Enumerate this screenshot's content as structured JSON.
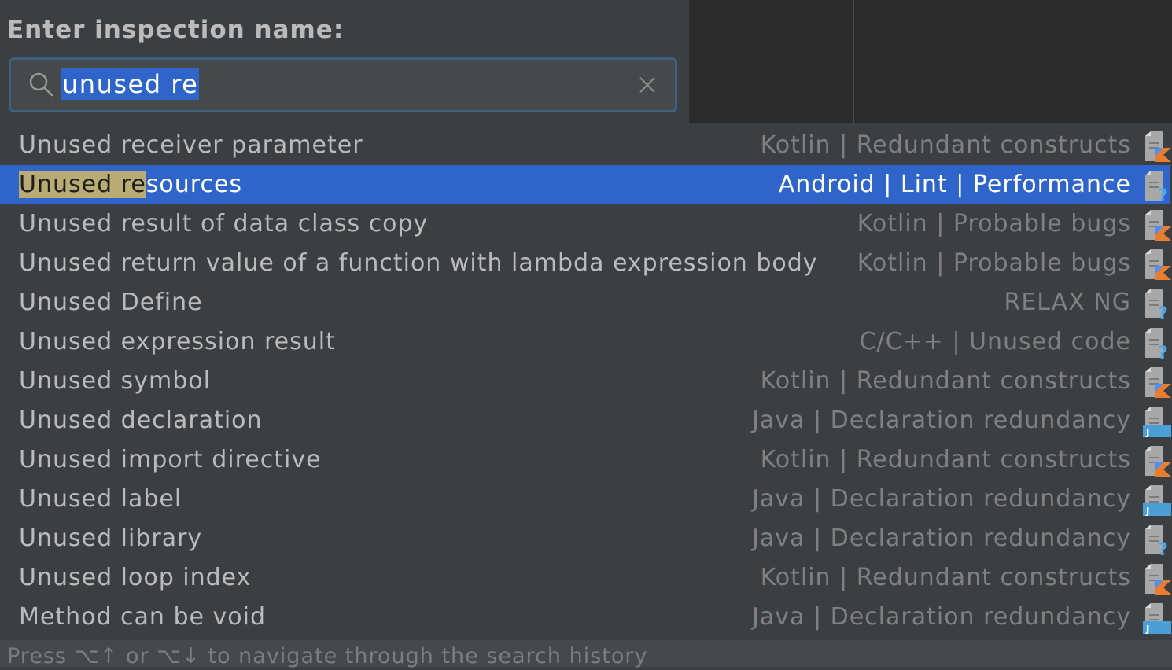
{
  "prompt": {
    "label": "Enter inspection name:"
  },
  "search": {
    "query": "unused re",
    "highlight": "Unused re",
    "icon": "search-icon",
    "clear_icon": "close-icon"
  },
  "results": [
    {
      "name": "Unused receiver parameter",
      "category": "Kotlin | Redundant constructs",
      "icon": "kotlin-inspection-icon",
      "selected": false
    },
    {
      "name": "Unused resources",
      "category": "Android | Lint | Performance",
      "icon": "unknown-inspection-icon",
      "selected": true
    },
    {
      "name": "Unused result of data class copy",
      "category": "Kotlin | Probable bugs",
      "icon": "kotlin-inspection-icon",
      "selected": false
    },
    {
      "name": "Unused return value of a function with lambda expression body",
      "category": "Kotlin | Probable bugs",
      "icon": "kotlin-inspection-icon",
      "selected": false
    },
    {
      "name": "Unused Define",
      "category": "RELAX NG",
      "icon": "unknown-inspection-icon",
      "selected": false
    },
    {
      "name": "Unused expression result",
      "category": "C/C++ | Unused code",
      "icon": "unknown-inspection-icon",
      "selected": false
    },
    {
      "name": "Unused symbol",
      "category": "Kotlin | Redundant constructs",
      "icon": "kotlin-inspection-icon",
      "selected": false
    },
    {
      "name": "Unused declaration",
      "category": "Java | Declaration redundancy",
      "icon": "java-inspection-icon",
      "selected": false
    },
    {
      "name": "Unused import directive",
      "category": "Kotlin | Redundant constructs",
      "icon": "kotlin-inspection-icon",
      "selected": false
    },
    {
      "name": "Unused label",
      "category": "Java | Declaration redundancy",
      "icon": "java-inspection-icon",
      "selected": false
    },
    {
      "name": "Unused library",
      "category": "Java | Declaration redundancy",
      "icon": "unknown-inspection-icon",
      "selected": false
    },
    {
      "name": "Unused loop index",
      "category": "Kotlin | Redundant constructs",
      "icon": "kotlin-inspection-icon",
      "selected": false
    },
    {
      "name": "Method can be void",
      "category": "Java | Declaration redundancy",
      "icon": "java-inspection-icon",
      "selected": false
    }
  ],
  "footer": {
    "hint": "Press ⌥↑ or ⌥↓ to navigate through the search history"
  },
  "colors": {
    "selection": "#2f65ca",
    "match_highlight": "#b8ab74",
    "kotlin_orange": "#e97d2f",
    "kotlin_blue": "#4c8ff5",
    "java_blue": "#4b9fd6"
  }
}
